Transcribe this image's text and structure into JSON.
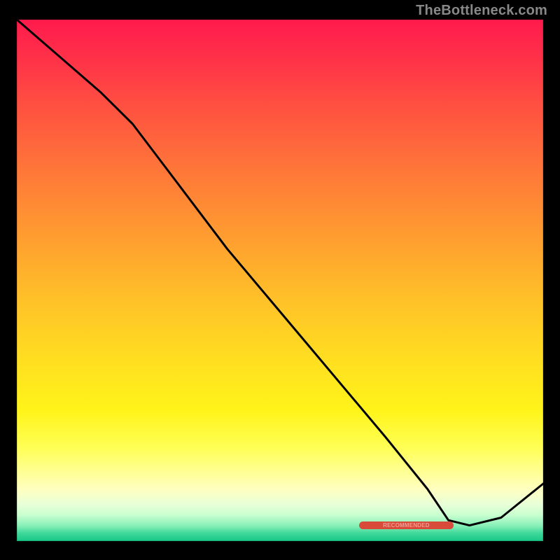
{
  "watermark": "TheBottleneck.com",
  "pill_label": "RECOMMENDED",
  "colors": {
    "watermark": "#888888",
    "pill_bg": "#d84a3a",
    "pill_text": "#ffe6e0",
    "curve": "#000000"
  },
  "chart_data": {
    "type": "line",
    "title": "",
    "xlabel": "",
    "ylabel": "",
    "xrange": [
      0,
      100
    ],
    "yrange": [
      0,
      100
    ],
    "grid": false,
    "legend": false,
    "background": "heat-gradient vertical (green bottom → red top)",
    "series": [
      {
        "name": "curve",
        "x": [
          0,
          8,
          16,
          22,
          28,
          40,
          55,
          70,
          78,
          82,
          86,
          92,
          100
        ],
        "y": [
          100,
          93,
          86,
          80,
          72,
          56,
          38,
          20,
          10,
          4,
          3,
          4.5,
          11
        ],
        "note": "y is percent of plot height from bottom; curve descends steeply, bottoms out near x≈85 at y≈3, then rises slightly"
      }
    ],
    "annotations": [
      {
        "type": "pill",
        "label_key": "pill_label",
        "x_center": 74,
        "y_center": 3,
        "width_pct": 18,
        "color_key": "pill_bg"
      }
    ]
  }
}
